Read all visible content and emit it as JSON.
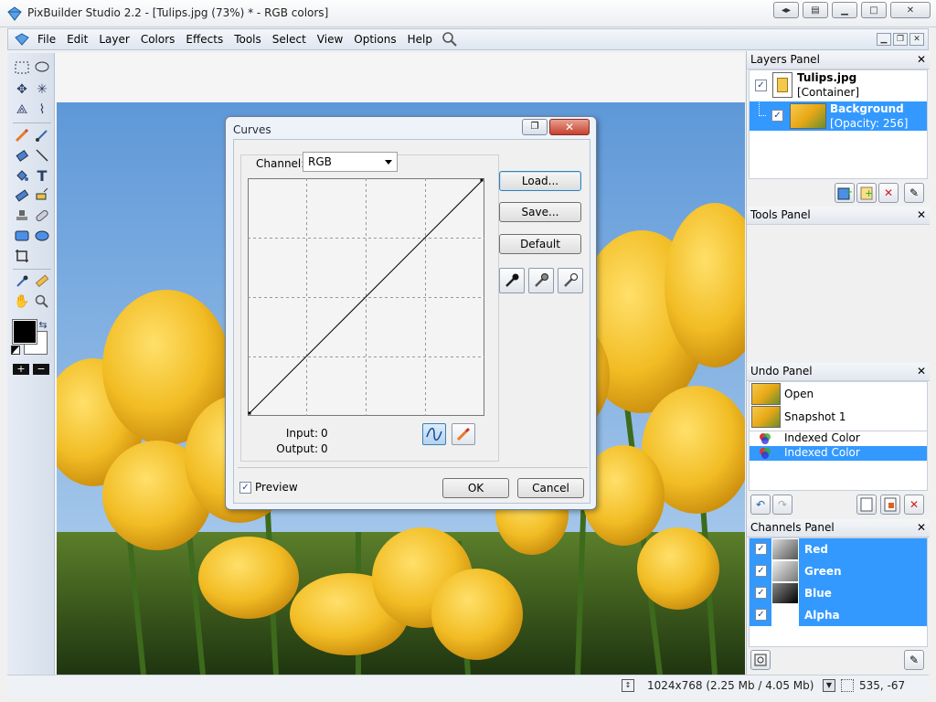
{
  "window": {
    "title": "PixBuilder Studio 2.2 - [Tulips.jpg (73%) * - RGB colors]"
  },
  "menu": {
    "items": [
      "File",
      "Edit",
      "Layer",
      "Colors",
      "Effects",
      "Tools",
      "Select",
      "View",
      "Options",
      "Help"
    ]
  },
  "layers_panel": {
    "title": "Layers Panel",
    "layers": [
      {
        "name": "Tulips.jpg",
        "sub": "[Container]",
        "checked": true,
        "selected": false
      },
      {
        "name": "Background",
        "sub": "[Opacity: 256]",
        "checked": true,
        "selected": true
      }
    ]
  },
  "tools_panel": {
    "title": "Tools Panel"
  },
  "undo_panel": {
    "title": "Undo Panel",
    "items": [
      {
        "label": "Open",
        "selected": false
      },
      {
        "label": "Snapshot 1",
        "selected": false
      },
      {
        "label": "Indexed Color",
        "selected": false
      },
      {
        "label": "Indexed Color",
        "selected": true
      }
    ]
  },
  "channels_panel": {
    "title": "Channels Panel",
    "channels": [
      {
        "label": "Red",
        "checked": true
      },
      {
        "label": "Green",
        "checked": true
      },
      {
        "label": "Blue",
        "checked": true
      },
      {
        "label": "Alpha",
        "checked": true
      }
    ]
  },
  "status": {
    "dimensions": "1024x768",
    "memory": "(2.25 Mb / 4.05 Mb)",
    "coords": "535, -67"
  },
  "curves_dialog": {
    "title": "Curves",
    "channel_label": "Channel:",
    "channel_value": "RGB",
    "input_label": "Input:",
    "input_value": "0",
    "output_label": "Output:",
    "output_value": "0",
    "load_label": "Load...",
    "save_label": "Save...",
    "default_label": "Default",
    "preview_label": "Preview",
    "preview_checked": true,
    "ok_label": "OK",
    "cancel_label": "Cancel"
  },
  "colors": {
    "selection": "#3399ff",
    "sky": "#77a8e0",
    "tulip": "#f2bd25"
  }
}
